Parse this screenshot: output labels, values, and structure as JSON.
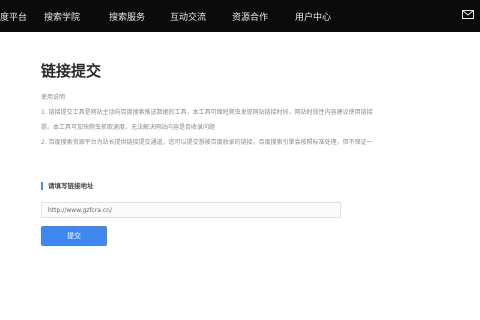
{
  "topbar": {
    "brand_fragment": "度平台",
    "nav": [
      "搜索学院",
      "搜索服务",
      "互动交流",
      "资源合作",
      "用户中心"
    ],
    "mail_icon": "mail-icon"
  },
  "page": {
    "title": "链接提交",
    "usage_header": "使用说明",
    "usage_lines": [
      "1. 链接提交工具是网站主动向百度搜索推送数据的工具，本工具可缩短爬虫发现网站链接时间，网站时效性内容建议使用链接",
      "提。本工具可加快爬虫抓取速度，无法解决网站内容是否收录问题",
      "2. 百度搜索资源平台为站长提供链接提交通道，您可以提交想被百度收录的链接，百度搜索引擎会按照标准处理，但不保证一"
    ]
  },
  "form": {
    "label": "请填写链接地址",
    "input_value": "http://www.gzfcra.cn/",
    "submit_label": "提交"
  },
  "colors": {
    "topbar_bg": "#0b0b0b",
    "accent": "#3f88f0",
    "label_bar": "#4e8bf0"
  }
}
